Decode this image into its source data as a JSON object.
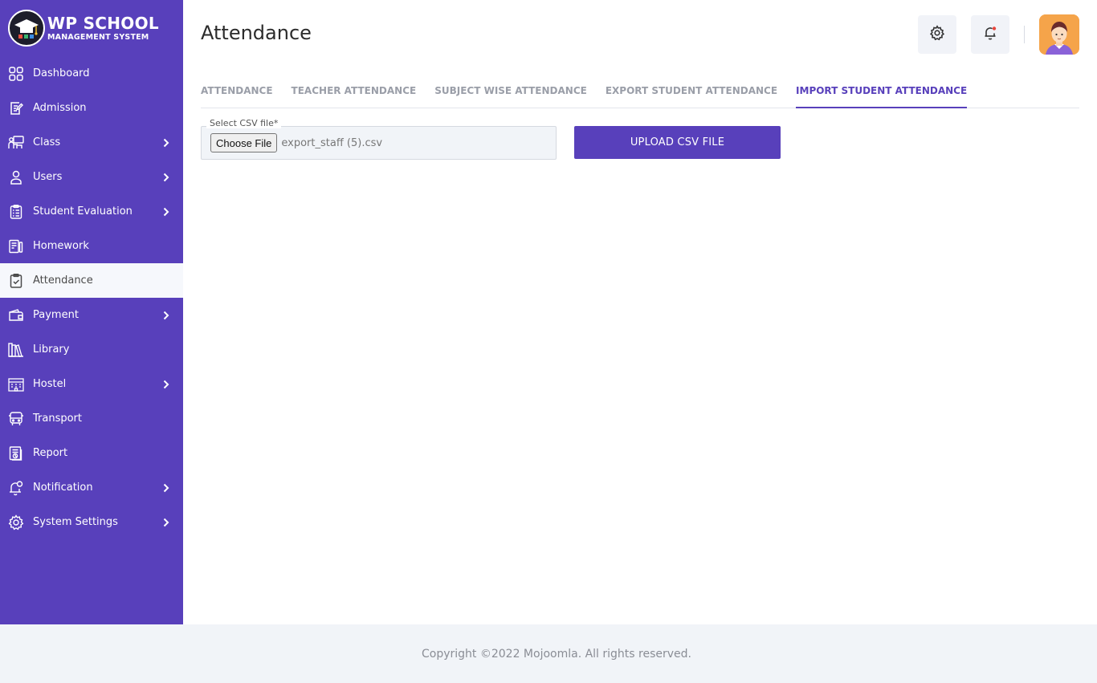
{
  "brand": {
    "title": "WP SCHOOL",
    "subtitle": "MANAGEMENT SYSTEM",
    "accent_color": "#5840bb"
  },
  "sidebar": {
    "items": [
      {
        "label": "Dashboard",
        "icon": "grid-icon",
        "has_submenu": false
      },
      {
        "label": "Admission",
        "icon": "edit-document-icon",
        "has_submenu": false
      },
      {
        "label": "Class",
        "icon": "classroom-icon",
        "has_submenu": true
      },
      {
        "label": "Users",
        "icon": "user-icon",
        "has_submenu": true
      },
      {
        "label": "Student Evaluation",
        "icon": "checklist-icon",
        "has_submenu": true
      },
      {
        "label": "Homework",
        "icon": "homework-icon",
        "has_submenu": false
      },
      {
        "label": "Attendance",
        "icon": "clipboard-check-icon",
        "has_submenu": false,
        "active": true
      },
      {
        "label": "Payment",
        "icon": "wallet-icon",
        "has_submenu": true
      },
      {
        "label": "Library",
        "icon": "books-icon",
        "has_submenu": false
      },
      {
        "label": "Hostel",
        "icon": "building-icon",
        "has_submenu": true
      },
      {
        "label": "Transport",
        "icon": "bus-icon",
        "has_submenu": false
      },
      {
        "label": "Report",
        "icon": "report-icon",
        "has_submenu": false
      },
      {
        "label": "Notification",
        "icon": "bell-icon",
        "has_submenu": true
      },
      {
        "label": "System Settings",
        "icon": "gear-icon",
        "has_submenu": true
      }
    ]
  },
  "header": {
    "title": "Attendance"
  },
  "tabs": [
    {
      "label": "ATTENDANCE"
    },
    {
      "label": "TEACHER ATTENDANCE"
    },
    {
      "label": "SUBJECT WISE ATTENDANCE"
    },
    {
      "label": "EXPORT STUDENT ATTENDANCE"
    },
    {
      "label": "IMPORT STUDENT ATTENDANCE",
      "active": true
    }
  ],
  "form": {
    "csv_label": "Select CSV file*",
    "choose_button": "Choose File",
    "file_name": "export_staff (5).csv",
    "upload_button": "UPLOAD CSV FILE"
  },
  "footer": {
    "text": "Copyright ©2022 Mojoomla. All rights reserved."
  }
}
